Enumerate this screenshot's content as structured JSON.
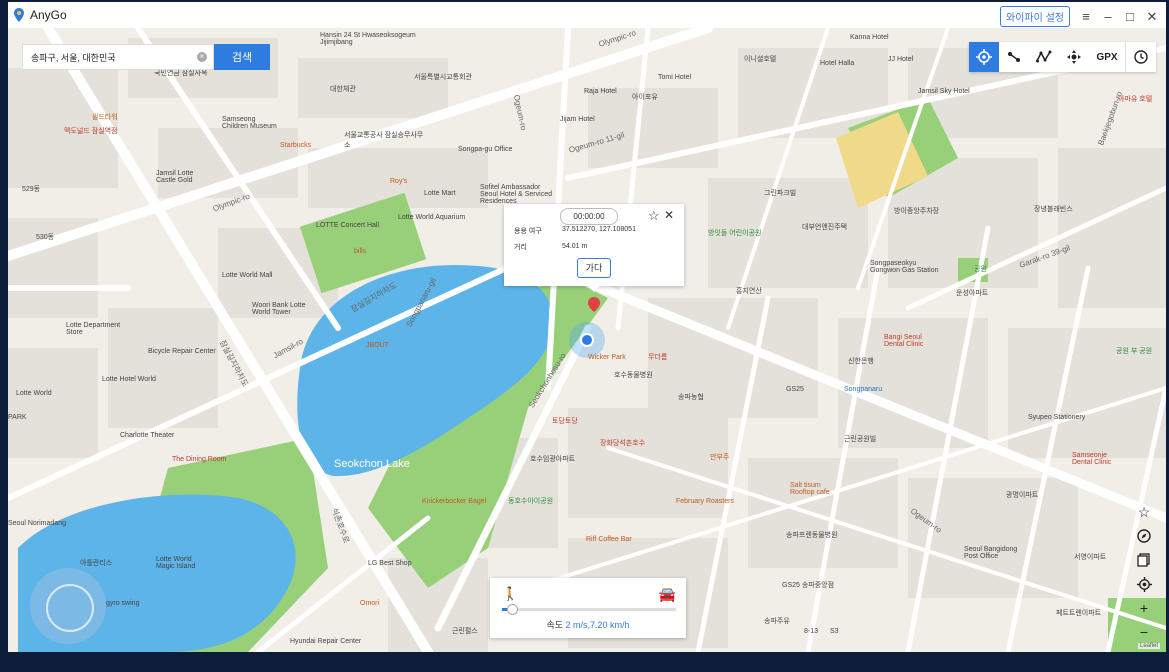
{
  "app": {
    "title": "AnyGo",
    "wifi_button": "와이파이 설정"
  },
  "titlebar_icons": [
    "menu-icon",
    "minimize-icon",
    "maximize-icon",
    "close-icon"
  ],
  "search": {
    "value": "송파구, 서울, 대한민국",
    "button": "검색"
  },
  "modes": [
    {
      "name": "teleport-mode-icon",
      "active": true
    },
    {
      "name": "two-spot-mode-icon",
      "active": false
    },
    {
      "name": "multi-spot-mode-icon",
      "active": false
    },
    {
      "name": "joystick-mode-icon",
      "active": false
    },
    {
      "name": "gpx-import",
      "label": "GPX"
    },
    {
      "name": "history-icon",
      "active": false
    }
  ],
  "popup": {
    "timer": "00:00:00",
    "coord_label": "용용 여구",
    "coords": "37.512270, 127.108051",
    "distance_label": "거리",
    "distance": "54.01 m",
    "go_button": "가다"
  },
  "speed": {
    "label": "속도",
    "value": "2 m/s,7.20 km/h",
    "level": 0.05
  },
  "map_labels": {
    "l1": "Hansin 24 St Hwaseoksogeum Jijimjibang",
    "l2": "서울특별시교통회관",
    "l3": "대한체관",
    "l4": "국민연금 잠실사옥",
    "l5": "윌드타워",
    "l6": "맥도널드 잠실역점",
    "l7": "Samseong Children Museum",
    "l8": "서울교통공사 잠실승무사무소",
    "l9": "Starbucks",
    "l10": "Songpa-gu Office",
    "l11": "Roy's",
    "l12": "Lotte Mart",
    "l13": "Sofitel Ambassador Seoul Hotel & Serviced Residences",
    "l14": "Jamsil Lotte Castle Gold",
    "l15": "LOTTE Concert Hall",
    "l16": "Lotte World Aquarium",
    "l17": "bills",
    "l18": "Lotte World Mall",
    "l19": "Woori Bank Lotte World Tower",
    "l20": "잠실길지하차도",
    "l21": "Lotte Department Store",
    "l22": "Bicycle Repair Center",
    "l23": "Lotte Hotel World",
    "l24": "Lotte World",
    "l25": "Charlotte Theater",
    "l26": "The Dining Room",
    "l27": "JBOUT",
    "l28": "Seokchon Lake",
    "l29": "Wicker Park",
    "l30": "호수동물병원",
    "l31": "송파농협",
    "l32": "토당토당",
    "l33": "장화당석촌호수",
    "l34": "호수임광아파트",
    "l35": "만부주",
    "l36": "Knickerbocker Bagel",
    "l37": "동호수아이공원",
    "l38": "February Roasters",
    "l39": "Riff Coffee Bar",
    "l40": "Salt tisum Rooftop cafe",
    "l41": "송파프렌동물병원",
    "l42": "GS25 송파중앙점",
    "l43": "LG Best Shop",
    "l44": "Omori",
    "l45": "Hyundai Repair Center",
    "l46": "근린펄스",
    "l47": "Seoul Norimadang",
    "l48": "Lotte World Magic Island",
    "l49": "아틀란티스",
    "l50": "gyro swing",
    "l51": "Kanna Hotel",
    "l52": "Hotel Halla",
    "l53": "JJ Hotel",
    "l54": "Jamsil Sky Hotel",
    "l55": "Raja Hotel",
    "l56": "Tomi Hotel",
    "l57": "Jijam Hotel",
    "l58": "아이포유",
    "l59": "이니셜호텔",
    "l60": "아마유 호텔",
    "l61": "그린파크빌",
    "l62": "방이중앙주차장",
    "l63": "장녕블래빈스",
    "l64": "방잇돌 어린이공원",
    "l65": "대부언앤진주택",
    "l66": "Songpaseokyu Gongwon Gas Station",
    "l67": "공원",
    "l68": "운성아파트",
    "l69": "흥지연산",
    "l70": "Bangi Seoul Dental Clinic",
    "l71": "신한은행",
    "l72": "Songpanaru",
    "l73": "GS25",
    "l74": "공원 부 공원",
    "l75": "Syupeo Stationery",
    "l76": "근린공원빌",
    "l77": "Samseonje Dental Clinic",
    "l78": "광명이파트",
    "l79": "Seoul Bangidong Post Office",
    "l80": "서영이파트",
    "l81": "페트트렌이파트",
    "l82": "8-13",
    "l83": "S3",
    "l84": "송파주유",
    "l85": "529동",
    "l86": "530동",
    "l87": "PARK",
    "l88": "무더름",
    "l89": "Olympic-ro",
    "l90": "Olympic-ro",
    "l91": "Ogeum-ro 11-gil",
    "l92": "Ogeum-ro",
    "l93": "Jamsil-ro",
    "l94": "Seokchonhosu-ro",
    "l95": "Baekjegobun-ro",
    "l96": "Garak-ro 39-gil",
    "l97": "Ogeum-ro",
    "l98": "석촌호수로",
    "l99": "잠실길지하차도",
    "l100": "Songpanaru-gil"
  },
  "right_tools": [
    "favorite-star-icon",
    "compass-icon",
    "layers-icon",
    "locate-icon",
    "zoom-in-icon",
    "zoom-out-icon"
  ],
  "attribution": "Leaflet",
  "colors": {
    "accent": "#2f7ce0",
    "land": "#f1eee8",
    "block": "#e4e1da",
    "road": "#ffffff",
    "park": "#98d07a",
    "water": "#5db4e8"
  }
}
